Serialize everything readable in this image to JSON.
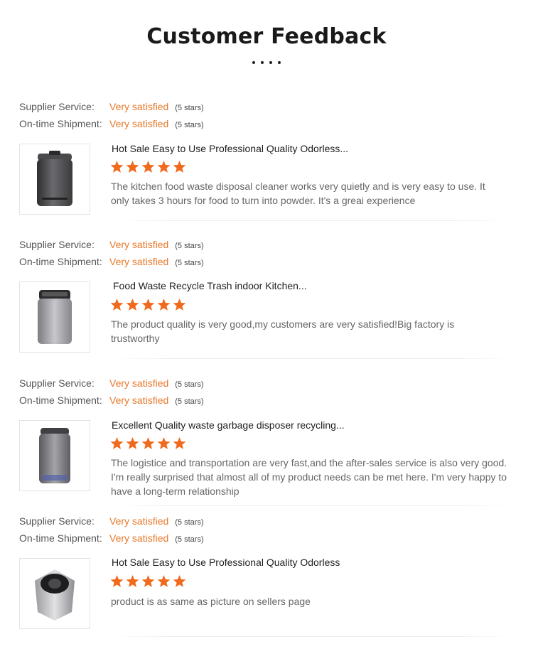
{
  "header": {
    "title": "Customer Feedback"
  },
  "colors": {
    "accent": "#e8782a",
    "star": "#f06a1e"
  },
  "reviews": [
    {
      "supplier_label": "Supplier Service:",
      "supplier_value": "Very satisfied",
      "supplier_stars": "(5 stars)",
      "shipment_label": "On-time Shipment:",
      "shipment_value": "Very satisfied",
      "shipment_stars": "(5 stars)",
      "product_image_icon": "dark-trash-bin-icon",
      "product_title": "Hot Sale Easy to Use Professional Quality Odorless...",
      "rating": 5,
      "comment": "The kitchen food waste disposal cleaner works very quietly and is very easy to use. It only takes 3 hours for food to turn into powder. It's a greai experience"
    },
    {
      "supplier_label": "Supplier Service:",
      "supplier_value": "Very satisfied",
      "supplier_stars": "(5 stars)",
      "shipment_label": "On-time Shipment:",
      "shipment_value": "Very satisfied",
      "shipment_stars": "(5 stars)",
      "product_image_icon": "silver-trash-bin-icon",
      "product_title": "Food Waste Recycle Trash indoor Kitchen...",
      "rating": 5,
      "comment": "The product quality is very good,my customers are very satisfied!Big factory is trustworthy"
    },
    {
      "supplier_label": "Supplier Service:",
      "supplier_value": "Very satisfied",
      "supplier_stars": "(5 stars)",
      "shipment_label": "On-time Shipment:",
      "shipment_value": "Very satisfied",
      "shipment_stars": "(5 stars)",
      "product_image_icon": "grey-disposer-bin-icon",
      "product_title": "Excellent Quality waste garbage disposer recycling...",
      "rating": 5,
      "comment": "The logistice and transportation are very fast,and the after-sales service is also very good. I'm really surprised that almost all of my product needs can be met here. I'm very happy to have a long-term relationship"
    },
    {
      "supplier_label": "Supplier Service:",
      "supplier_value": "Very satisfied",
      "supplier_stars": "(5 stars)",
      "shipment_label": "On-time Shipment:",
      "shipment_value": "Very satisfied",
      "shipment_stars": "(5 stars)",
      "product_image_icon": "open-top-bin-icon",
      "product_title": "Hot Sale Easy to Use Professional Quality Odorless",
      "rating": 5,
      "comment": "product is as same as picture on sellers page"
    }
  ]
}
